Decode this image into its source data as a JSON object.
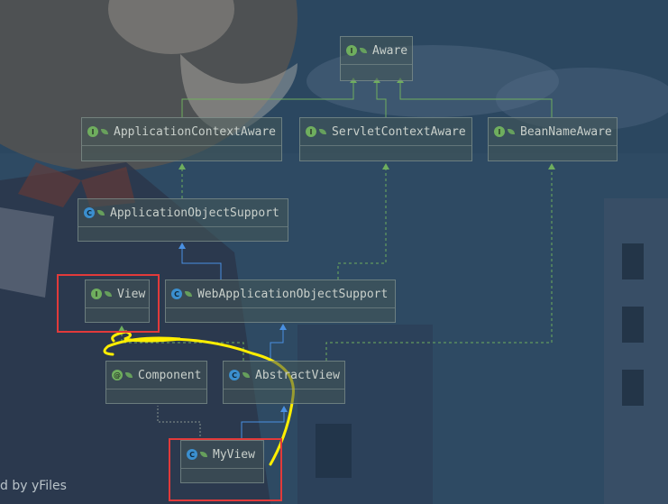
{
  "nodes": {
    "aware": {
      "label": "Aware",
      "badge": "I"
    },
    "application_context_aware": {
      "label": "ApplicationContextAware",
      "badge": "I"
    },
    "servlet_context_aware": {
      "label": "ServletContextAware",
      "badge": "I"
    },
    "bean_name_aware": {
      "label": "BeanNameAware",
      "badge": "I"
    },
    "application_object_support": {
      "label": "ApplicationObjectSupport",
      "badge": "C"
    },
    "view": {
      "label": "View",
      "badge": "I"
    },
    "web_application_object_support": {
      "label": "WebApplicationObjectSupport",
      "badge": "C"
    },
    "component": {
      "label": "Component",
      "badge": "@"
    },
    "abstract_view": {
      "label": "AbstractView",
      "badge": "C"
    },
    "my_view": {
      "label": "MyView",
      "badge": "C"
    }
  },
  "watermark": "d by yFiles",
  "colors": {
    "interface_edge": "#6fae5e",
    "class_edge": "#4a90e2",
    "highlight": "#e23a3a",
    "scribble": "#ffee00"
  }
}
